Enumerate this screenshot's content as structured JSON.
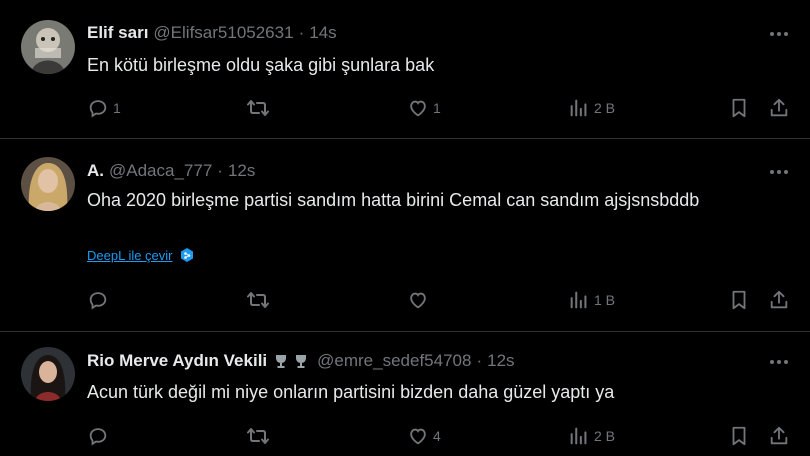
{
  "tweets": [
    {
      "name": "Elif sarı",
      "handle": "@Elifsar51052631",
      "time": "14s",
      "text": "En kötü birleşme oldu şaka gibi şunlara bak",
      "translate": "",
      "replies": "1",
      "retweets": "",
      "likes": "1",
      "views": "2 B"
    },
    {
      "name": "A.",
      "handle": "@Adaca_777",
      "time": "12s",
      "text": "Oha 2020 birleşme partisi sandım hatta birini Cemal can sandım ajsjsnsbddb",
      "translate": "DeepL ile çevir",
      "replies": "",
      "retweets": "",
      "likes": "",
      "views": "1 B"
    },
    {
      "name": "Rio Merve Aydın Vekili",
      "handle": "@emre_sedef54708",
      "time": "12s",
      "text": "Acun türk değil mi niye onların partisini bizden daha güzel yaptı ya",
      "translate": "",
      "replies": "",
      "retweets": "",
      "likes": "4",
      "views": "2 B"
    }
  ],
  "separator": "·",
  "icons": {
    "reply": "reply-icon",
    "retweet": "retweet-icon",
    "like": "heart-icon",
    "views": "views-bar-icon",
    "bookmark": "bookmark-icon",
    "share": "share-icon",
    "more": "more-icon",
    "badge": "trophy-emoji-icon",
    "deepl": "deepl-logo-icon"
  },
  "colors": {
    "background": "#000000",
    "text": "#e7e9ea",
    "secondary": "#71767b",
    "link": "#1d9bf0",
    "divider": "#2f3336"
  }
}
